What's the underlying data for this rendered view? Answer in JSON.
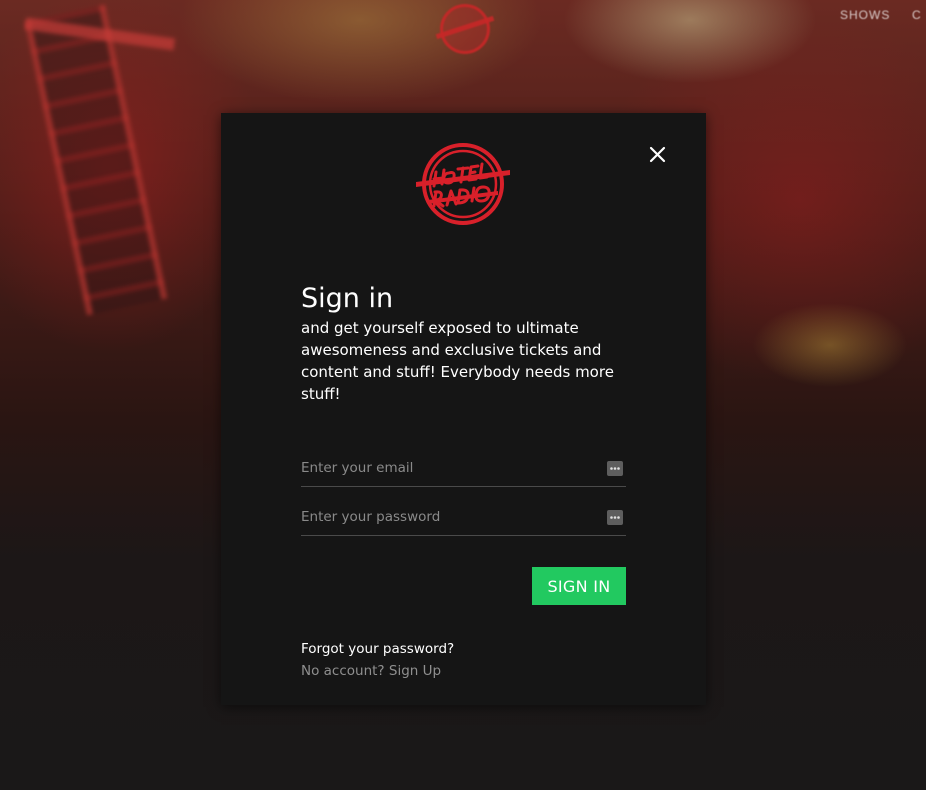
{
  "background": {
    "nav_items": [
      "SHOWS",
      "C"
    ]
  },
  "modal": {
    "logo_text": "Hotel Radio",
    "close_icon": "close-icon",
    "title": "Sign in",
    "subtitle": "and get yourself exposed to ultimate awesomeness and exclusive tickets and content and stuff! Everybody needs more stuff!",
    "email": {
      "placeholder": "Enter your email",
      "value": "",
      "icon": "password-manager-dots-icon"
    },
    "password": {
      "placeholder": "Enter your password",
      "value": "",
      "icon": "password-manager-dots-icon"
    },
    "signin_label": "SIGN IN",
    "forgot_label": "Forgot your password?",
    "signup_label": "No account? Sign Up"
  },
  "colors": {
    "modal_bg": "#151515",
    "accent_green": "#22c960",
    "logo_red": "#d8202a",
    "muted_text": "#8f8f8f"
  }
}
